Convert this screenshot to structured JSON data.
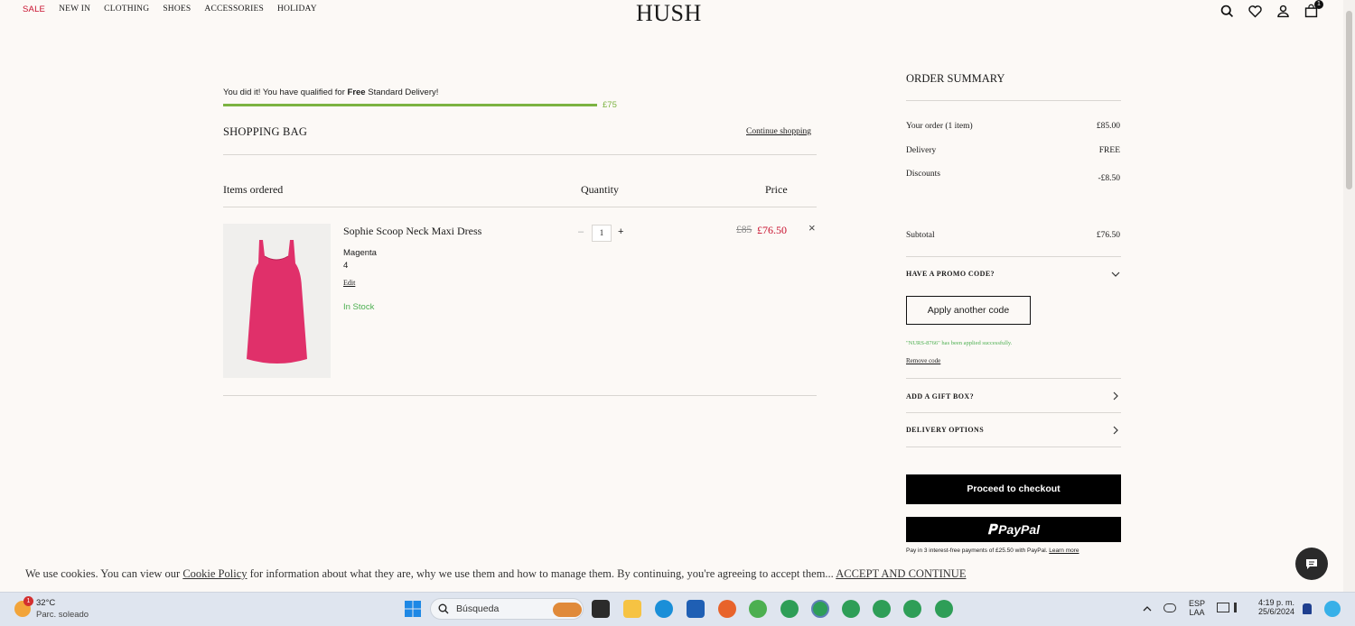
{
  "header": {
    "nav": [
      "SALE",
      "NEW IN",
      "CLOTHING",
      "SHOES",
      "ACCESSORIES",
      "HOLIDAY"
    ],
    "logo": "HUSH",
    "icons": [
      "search-icon",
      "heart-icon",
      "account-icon",
      "bag-icon"
    ],
    "bag_count": "1"
  },
  "delivery": {
    "message_prefix": "You did it! You have qualified for ",
    "message_bold": "Free",
    "message_suffix": " Standard Delivery!",
    "threshold": "£75",
    "progress": 1.0
  },
  "bag": {
    "title": "SHOPPING BAG",
    "continue_label": "Continue shopping",
    "columns": [
      "Items ordered",
      "Quantity",
      "Price"
    ],
    "item": {
      "name": "Sophie Scoop Neck Maxi Dress",
      "color": "Magenta",
      "size": "4",
      "edit_label": "Edit",
      "stock": "In Stock",
      "qty_minus": "–",
      "quantity": "1",
      "qty_plus": "+",
      "old_price": "£85",
      "new_price": "£76.50",
      "remove": "×"
    }
  },
  "summary": {
    "title": "ORDER SUMMARY",
    "rows": [
      {
        "label": "Your order (1 item)",
        "value": "£85.00"
      },
      {
        "label": "Delivery",
        "value": "FREE"
      },
      {
        "label": "Discounts",
        "value": "-£8.50"
      }
    ],
    "subtotal_label": "Subtotal",
    "subtotal_value": "£76.50",
    "promo_title": "HAVE A PROMO CODE?",
    "apply_label": "Apply another code",
    "applied_msg": "\"NURS-8766\" has been applied successfully.",
    "remove_code": "Remove code",
    "gift_title": "ADD A GIFT BOX?",
    "delivery_title": "DELIVERY OPTIONS",
    "checkout_label": "Proceed to checkout",
    "paypal_label": "PayPal",
    "paypal_note": "Pay in 3 interest-free payments of £25.50 with PayPal.",
    "paypal_learn": "Learn more"
  },
  "cookie": {
    "text1": "We use cookies. You can view our ",
    "link": "Cookie Policy",
    "text2": " for information about what they are, why we use them and how to manage them. By continuing, you're agreeing to accept them... ",
    "accept": "ACCEPT AND CONTINUE"
  },
  "taskbar": {
    "weather_badge": "1",
    "temp": "32°C",
    "condition": "Parc. soleado",
    "search_placeholder": "Búsqueda",
    "lang1": "ESP",
    "lang2": "LAA",
    "time": "4:19 p. m.",
    "date": "25/6/2024",
    "colors": {
      "accent": "#c8102e",
      "progress": "#7cb342",
      "success": "#4caf50"
    }
  }
}
